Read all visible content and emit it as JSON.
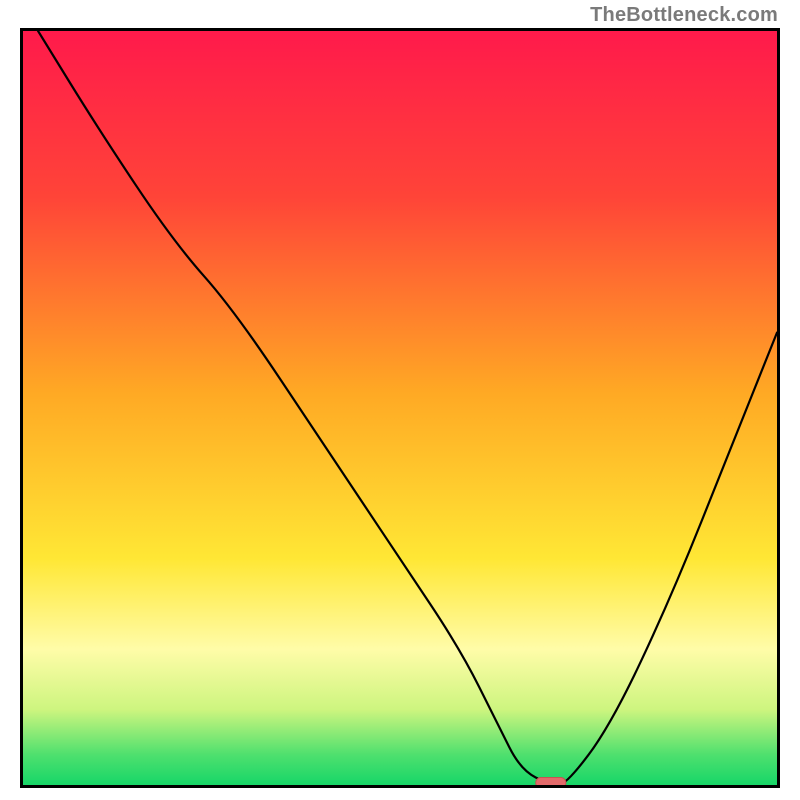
{
  "watermark": "TheBottleneck.com",
  "colors": {
    "top": "#ff1a4b",
    "red": "#ff2a44",
    "orange": "#ff8a2a",
    "yellow": "#ffe935",
    "pale_yellow": "#fffcb0",
    "green_light": "#8fe96d",
    "green": "#22d86a",
    "frame": "#000000",
    "curve": "#000000",
    "marker_fill": "#e26a6a",
    "marker_stroke": "#c74f4f"
  },
  "chart_data": {
    "type": "line",
    "title": "",
    "xlabel": "",
    "ylabel": "",
    "xlim": [
      0,
      100
    ],
    "ylim": [
      0,
      100
    ],
    "series": [
      {
        "name": "bottleneck-curve",
        "x": [
          2,
          10,
          20,
          28,
          40,
          50,
          58,
          63,
          66,
          70,
          72,
          78,
          86,
          94,
          100
        ],
        "y": [
          100,
          87,
          72,
          63,
          45,
          30,
          18,
          8,
          2,
          0,
          0,
          8,
          25,
          45,
          60
        ]
      }
    ],
    "marker": {
      "x": 70,
      "y": 0,
      "width_pct": 4,
      "height_pct": 1.4
    },
    "gradient_stops": [
      {
        "pct": 0,
        "color": "#ff1a4b"
      },
      {
        "pct": 22,
        "color": "#ff4438"
      },
      {
        "pct": 48,
        "color": "#ffa924"
      },
      {
        "pct": 70,
        "color": "#ffe735"
      },
      {
        "pct": 82,
        "color": "#fffca8"
      },
      {
        "pct": 90,
        "color": "#cdf57f"
      },
      {
        "pct": 96,
        "color": "#4ee06e"
      },
      {
        "pct": 100,
        "color": "#17d668"
      }
    ]
  }
}
